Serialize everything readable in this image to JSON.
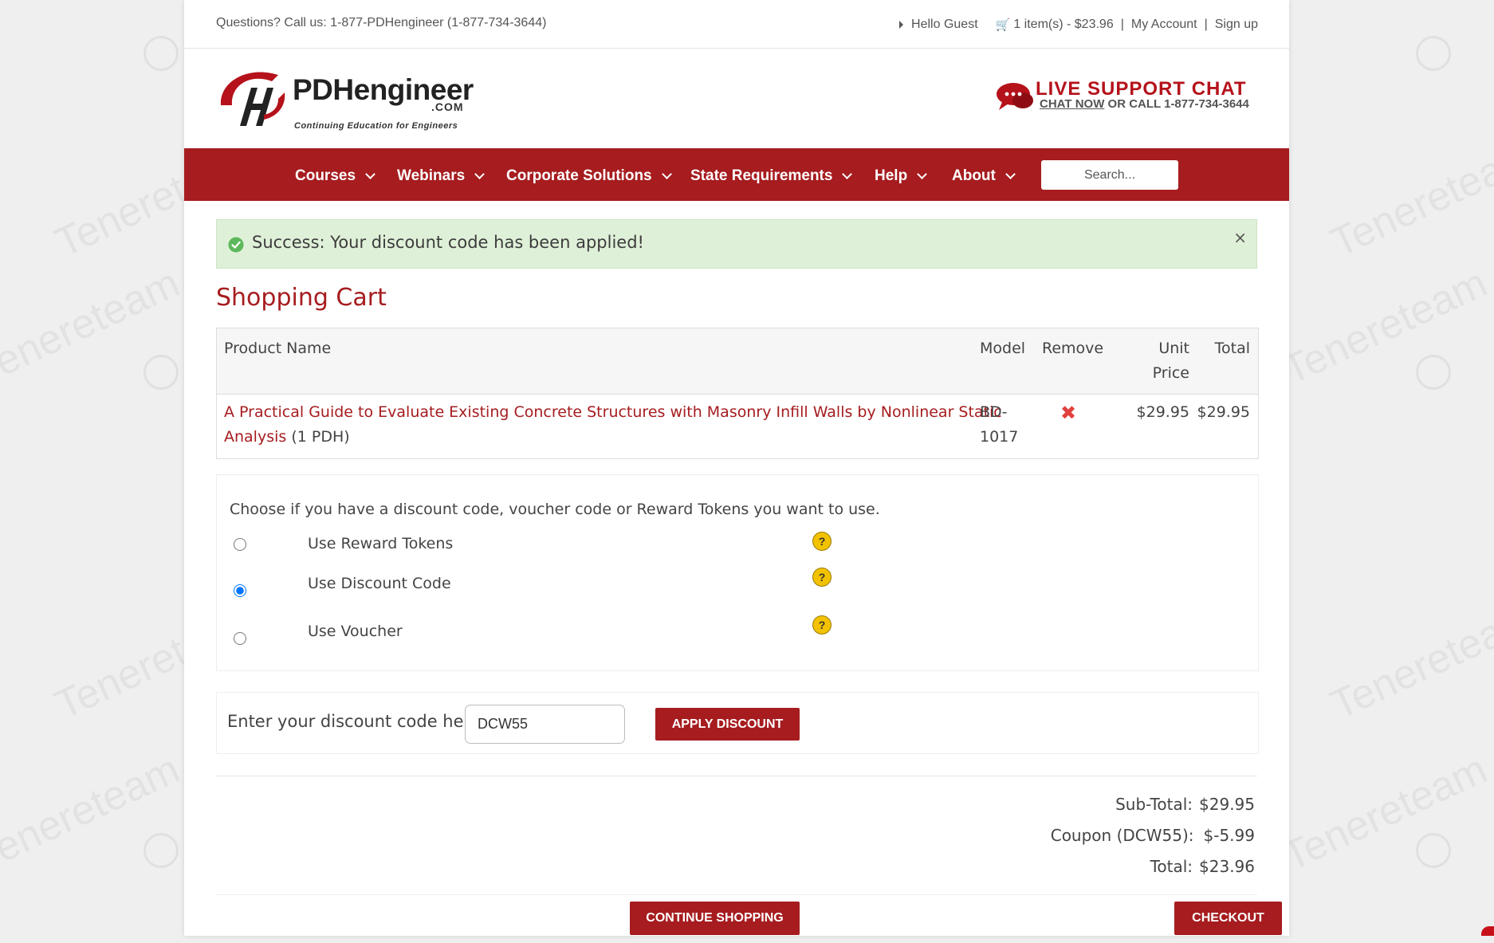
{
  "topbar": {
    "phone": "Questions? Call us: 1-877-PDHengineer (1-877-734-3644)",
    "hello": "Hello Guest",
    "cart": "1 item(s) - $23.96",
    "my_account": "My Account",
    "sign_up": "Sign up"
  },
  "logo": {
    "word": "PDHengineer",
    "com": ".COM",
    "tagline": "Continuing Education for Engineers"
  },
  "live_chat": {
    "title": "LIVE SUPPORT CHAT",
    "chat_now": "CHAT NOW",
    "or_call": " OR CALL 1-877-734-3644"
  },
  "nav": {
    "items": [
      "Courses",
      "Webinars",
      "Corporate Solutions",
      "State Requirements",
      "Help",
      "About"
    ],
    "search_placeholder": "Search..."
  },
  "alert": {
    "message": "Success: Your discount code has been applied!",
    "close": "×"
  },
  "page_title": "Shopping Cart",
  "cart": {
    "headers": {
      "product": "Product Name",
      "model": "Model",
      "remove": "Remove",
      "unit_1": "Unit",
      "unit_2": "Price",
      "total": "Total"
    },
    "rows": [
      {
        "name_line1": "A Practical Guide to Evaluate Existing Concrete Structures with Masonry Infill Walls by Nonlinear Static",
        "name_line2": "Analysis",
        "credit": " (1 PDH)",
        "model_1": "BD-",
        "model_2": "1017",
        "remove_icon": "✖",
        "unit_price": "$29.95",
        "total": "$29.95"
      }
    ]
  },
  "discount_options": {
    "lead": "Choose if you have a discount code, voucher code or Reward Tokens you want to use.",
    "options": [
      {
        "label": "Use Reward Tokens",
        "checked": false
      },
      {
        "label": "Use Discount Code",
        "checked": true
      },
      {
        "label": "Use Voucher",
        "checked": false
      }
    ],
    "help_glyph": "?"
  },
  "discount_code": {
    "label": "Enter your discount code here:",
    "value": "DCW55",
    "button": "APPLY DISCOUNT"
  },
  "totals": {
    "subtotal_label": "Sub-Total:",
    "subtotal": "$29.95",
    "coupon_label": "Coupon (DCW55):",
    "coupon": "$-5.99",
    "total_label": "Total:",
    "total": "$23.96"
  },
  "buttons": {
    "continue": "CONTINUE SHOPPING",
    "checkout": "CHECKOUT"
  },
  "colors": {
    "brand_red": "#a61c1f",
    "alert_green_bg": "#dff0d8",
    "help_yellow": "#f2c200"
  },
  "watermark": "Tenereteam"
}
